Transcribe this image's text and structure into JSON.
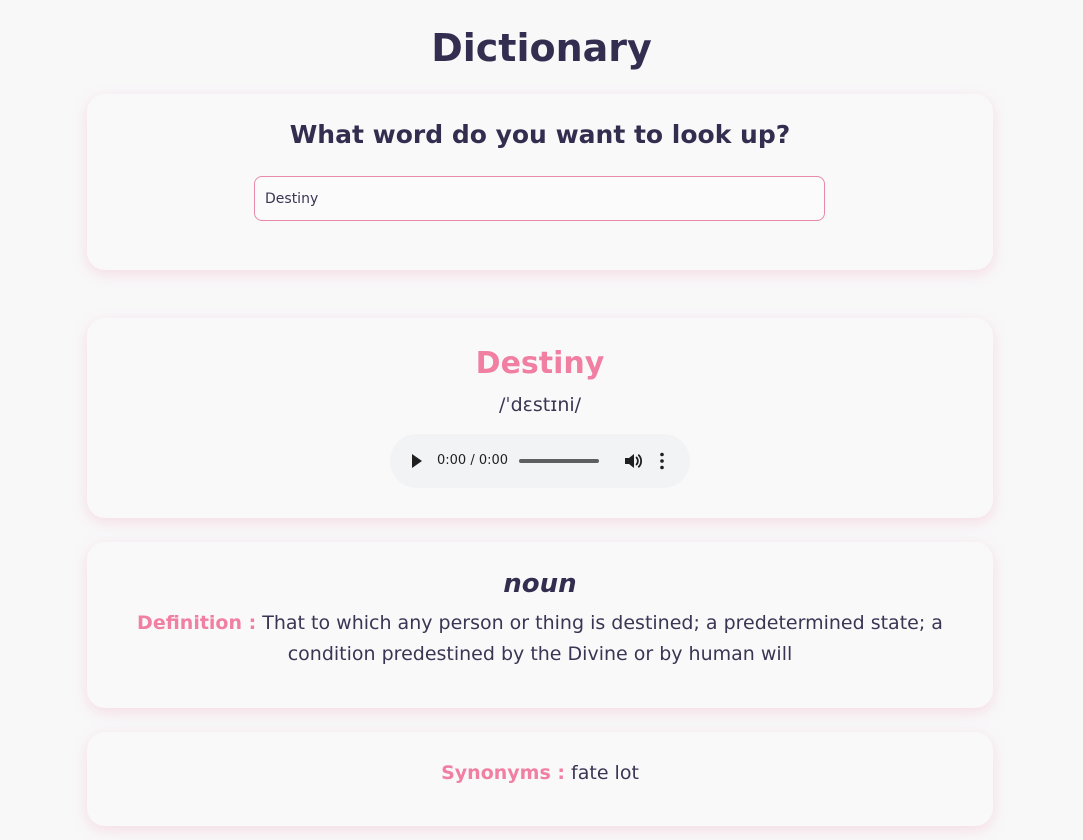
{
  "app": {
    "title": "Dictionary"
  },
  "search": {
    "heading": "What word do you want to look up?",
    "value": "Destiny"
  },
  "result": {
    "word": "Destiny",
    "phonetic": "/ˈdɛstɪni/",
    "audio": {
      "time": "0:00 / 0:00",
      "progress": 0
    },
    "meanings": [
      {
        "part_of_speech": "noun",
        "definition_label": "Definition :",
        "definition": "That to which any person or thing is destined; a predetermined state; a condition predestined by the Divine or by human will"
      }
    ],
    "synonyms_label": "Synonyms :",
    "synonyms": "fate lot"
  },
  "colors": {
    "accent": "#f07fa2",
    "heading": "#332d4f",
    "background": "#f8f8f9",
    "input_border": "#e88aa8"
  },
  "icons": {
    "play": "play-icon",
    "volume": "volume-icon",
    "more": "more-vertical-icon"
  }
}
